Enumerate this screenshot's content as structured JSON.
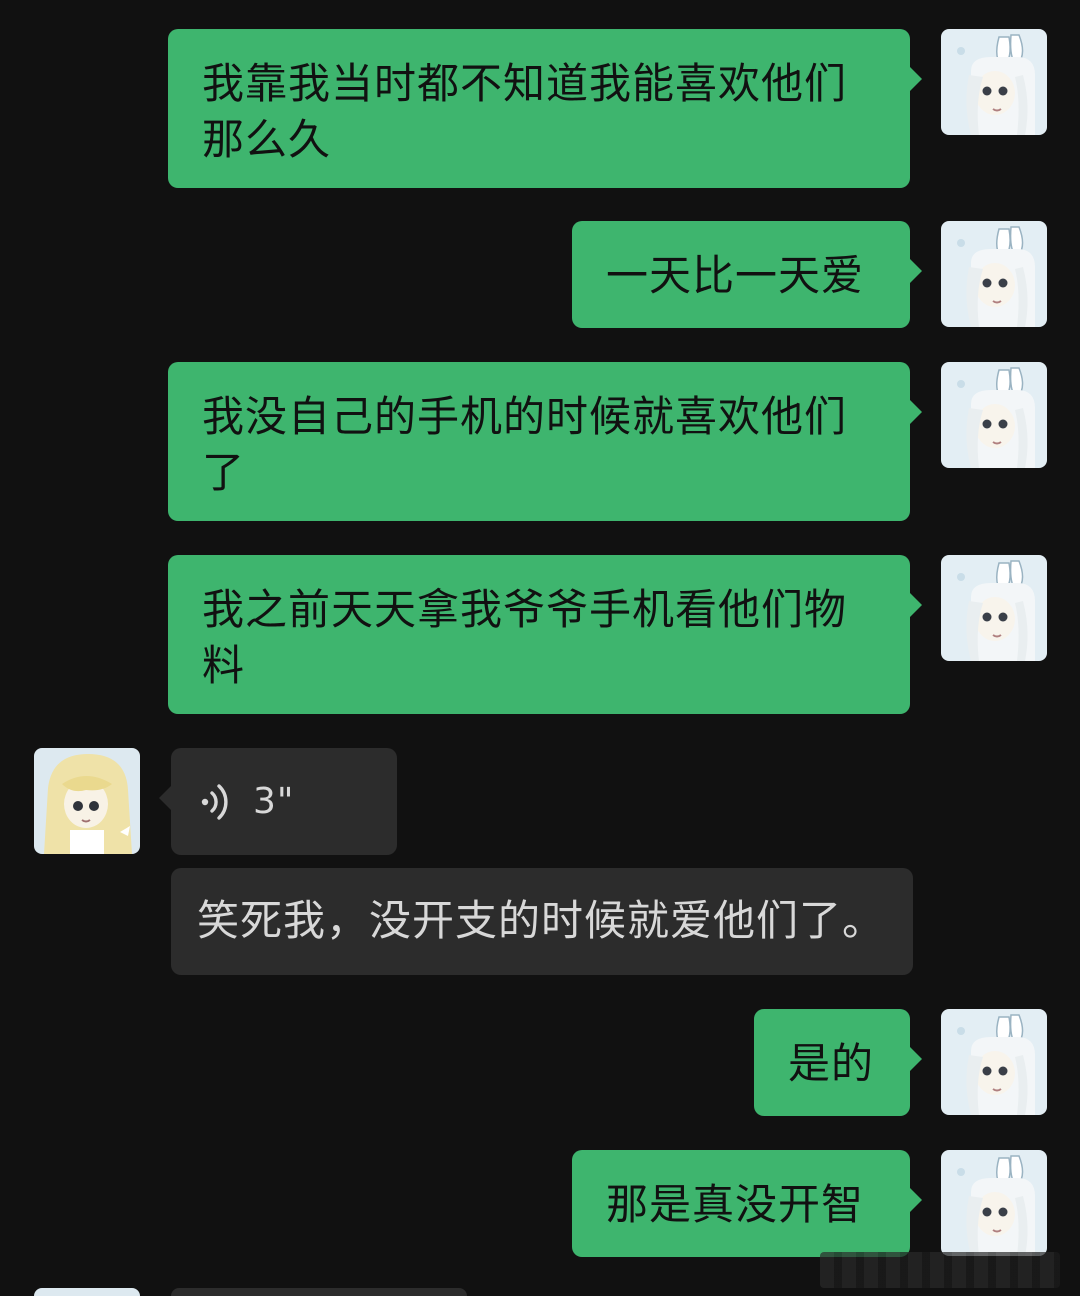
{
  "messages": [
    {
      "side": "me",
      "type": "text",
      "text": "我靠我当时都不知道我能喜欢他们那么久"
    },
    {
      "side": "me",
      "type": "text",
      "text": "一天比一天爱"
    },
    {
      "side": "me",
      "type": "text",
      "text": "我没自己的手机的时候就喜欢他们了"
    },
    {
      "side": "me",
      "type": "text",
      "text": "我之前天天拿我爷爷手机看他们物料"
    },
    {
      "side": "other",
      "type": "voice",
      "duration": "3\""
    },
    {
      "side": "other",
      "type": "text",
      "text": "笑死我，没开支的时候就爱他们了。"
    },
    {
      "side": "me",
      "type": "text",
      "text": "是的"
    },
    {
      "side": "me",
      "type": "text",
      "text": "那是真没开智"
    }
  ],
  "colors": {
    "background": "#111111",
    "my_bubble": "#3eb56e",
    "their_bubble": "#2c2c2c",
    "their_text": "#d8d8d8"
  },
  "icons": {
    "voice": "voice-wave-icon",
    "my_avatar": "bunny-girl-avatar",
    "their_avatar": "blonde-girl-avatar"
  }
}
